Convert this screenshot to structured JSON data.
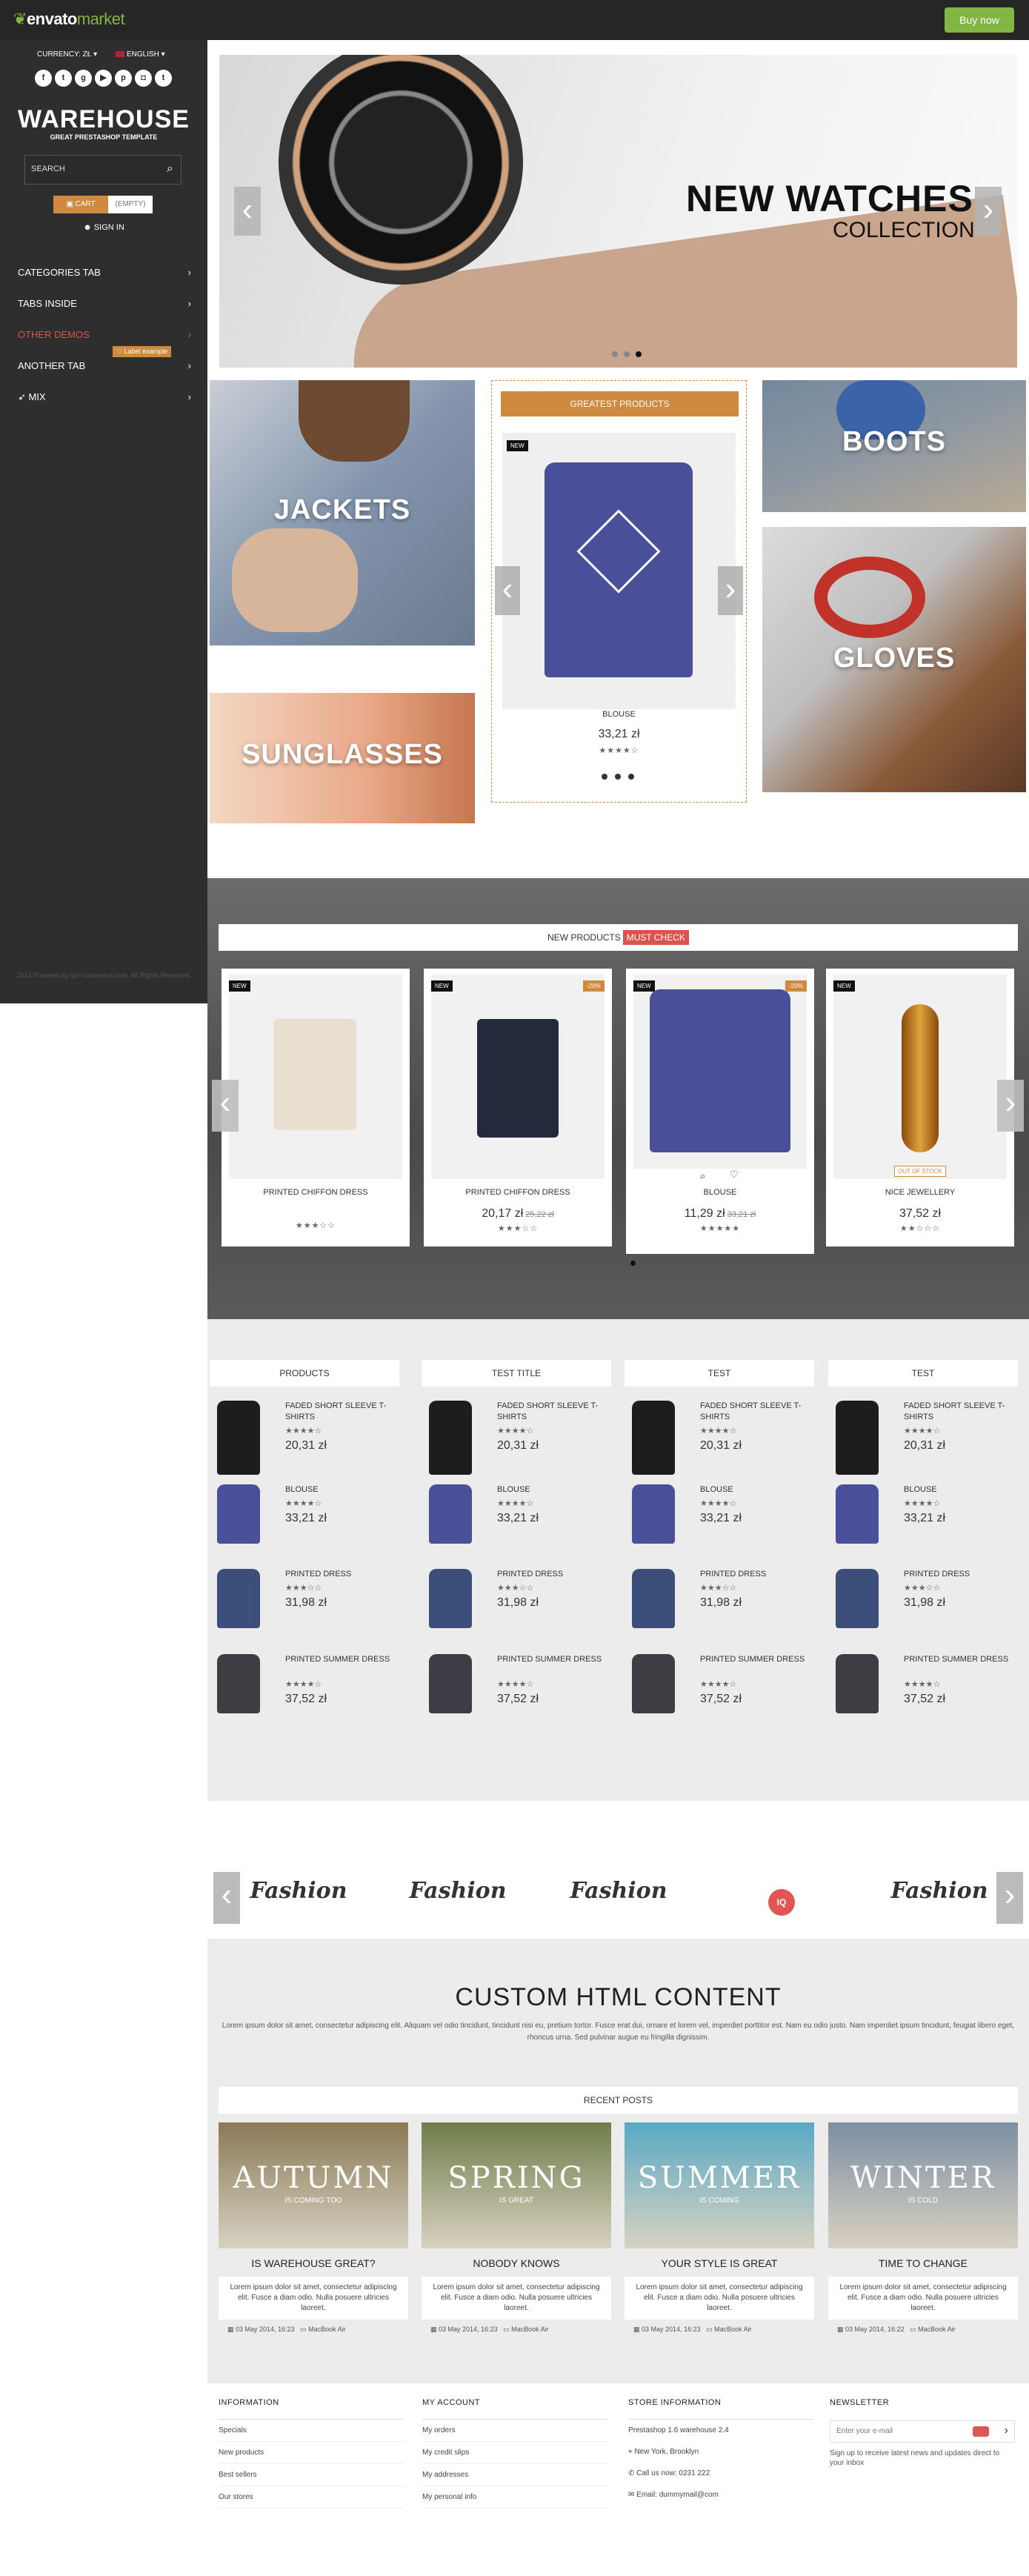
{
  "topbar": {
    "logo_main": "envato",
    "logo_accent": "market",
    "buy_label": "Buy now"
  },
  "sidebar": {
    "currency": "CURRENCY: ZŁ",
    "language": "ENGLISH",
    "socials": [
      "f",
      "t",
      "g+",
      "yt",
      "p",
      "ig",
      "tt"
    ],
    "title": "WAREHOUSE",
    "subtitle": "GREAT PRESTASHOP TEMPLATE",
    "search_placeholder": "SEARCH",
    "cart_label": "CART",
    "cart_state": "(EMPTY)",
    "signin": "SIGN IN",
    "nav": [
      {
        "label": "CATEGORIES TAB"
      },
      {
        "label": "TABS INSIDE"
      },
      {
        "label": "OTHER DEMOS"
      },
      {
        "label": "ANOTHER TAB"
      },
      {
        "label": "MIX"
      }
    ],
    "label_example": "Label example",
    "copyright": "2014 Powered by rps-commerce.com. All Rights Reserved."
  },
  "slider": {
    "title": "NEW WATCHES",
    "subtitle": "COLLECTION"
  },
  "banners": {
    "jackets": "JACKETS",
    "sunglasses": "SUNGLASSES",
    "boots": "BOOTS",
    "gloves": "GLOVES"
  },
  "greatest": {
    "header": "GREATEST PRODUCTS",
    "tag": "NEW",
    "name": "BLOUSE",
    "price": "33,21 zł",
    "stars": "★★★★☆"
  },
  "new_products": {
    "header": "NEW PRODUCTS",
    "must": "MUST CHECK",
    "items": [
      {
        "tag": "NEW",
        "sale": "",
        "name": "PRINTED CHIFFON DRESS",
        "price": "",
        "old": "",
        "stars": "★★★☆☆"
      },
      {
        "tag": "NEW",
        "sale": "-20%",
        "name": "PRINTED CHIFFON DRESS",
        "price": "20,17 zł",
        "old": "25,22 zł",
        "stars": "★★★☆☆"
      },
      {
        "tag": "NEW",
        "sale": "-20%",
        "name": "BLOUSE",
        "price": "11,29 zł",
        "old": "33,21 zł",
        "stars": "★★★★★"
      },
      {
        "tag": "NEW",
        "sale": "",
        "name": "NICE JEWELLERY",
        "price": "37,52 zł",
        "old": "",
        "stars": "★★☆☆☆",
        "stock": "OUT OF STOCK"
      }
    ]
  },
  "lists": {
    "columns": [
      {
        "head": "PRODUCTS"
      },
      {
        "head": "TEST TITLE"
      },
      {
        "head": "TEST"
      },
      {
        "head": "TEST"
      }
    ],
    "items": [
      {
        "name": "FADED SHORT SLEEVE T-SHIRTS",
        "price": "20,31 zł",
        "stars": "★★★★☆"
      },
      {
        "name": "BLOUSE",
        "price": "33,21 zł",
        "stars": "★★★★☆"
      },
      {
        "name": "PRINTED DRESS",
        "price": "31,98 zł",
        "stars": "★★★☆☆"
      },
      {
        "name": "PRINTED SUMMER DRESS",
        "price": "37,52 zł",
        "stars": "★★★★☆"
      }
    ]
  },
  "brands": [
    "Fashion",
    "Fashion",
    "Fashion",
    "IQ",
    "Fashion"
  ],
  "custom": {
    "title": "CUSTOM HTML CONTENT",
    "text": "Lorem ipsum dolor sit amet, consectetur adipiscing elit. Aliquam vel odio tincidunt, tincidunt nisi eu, pretium tortor. Fusce erat dui, ornare et lorem vel, imperdiet porttitor est. Nam eu odio justo. Nam imperdiet ipsum tincidunt, feugiat libero eget, rhoncus urna. Sed pulvinar augue eu fringilla dignissim."
  },
  "recent_posts": {
    "header": "RECENT POSTS",
    "posts": [
      {
        "word": "AUTUMN",
        "sub": "IS COMING TOO",
        "title": "IS WAREHOUSE GREAT?",
        "text": "Lorem ipsum dolor sit amet, consectetur adipiscing elit. Fusce a diam odio. Nulla posuere ultricies laoreet.",
        "date": "03 May 2014, 16:23",
        "author": "MacBook Air",
        "bg": "#8a7a56"
      },
      {
        "word": "SPRING",
        "sub": "IS GREAT",
        "title": "NOBODY KNOWS",
        "text": "Lorem ipsum dolor sit amet, consectetur adipiscing elit. Fusce a diam odio. Nulla posuere ultricies laoreet.",
        "date": "03 May 2014, 16:23",
        "author": "MacBook Air",
        "bg": "#6f7d4a"
      },
      {
        "word": "SUMMER",
        "sub": "IS COMING",
        "title": "YOUR STYLE IS GREAT",
        "text": "Lorem ipsum dolor sit amet, consectetur adipiscing elit. Fusce a diam odio. Nulla posuere ultricies laoreet.",
        "date": "03 May 2014, 16:23",
        "author": "MacBook Air",
        "bg": "#59a9c4"
      },
      {
        "word": "WINTER",
        "sub": "IS COLD",
        "title": "TIME TO CHANGE",
        "text": "Lorem ipsum dolor sit amet, consectetur adipiscing elit. Fusce a diam odio. Nulla posuere ultricies laoreet.",
        "date": "03 May 2014, 16:22",
        "author": "MacBook Air",
        "bg": "#7d8fa3"
      }
    ]
  },
  "footer": {
    "information": {
      "head": "INFORMATION",
      "links": [
        "Specials",
        "New products",
        "Best sellers",
        "Our stores"
      ]
    },
    "account": {
      "head": "MY ACCOUNT",
      "links": [
        "My orders",
        "My credit slips",
        "My addresses",
        "My personal info"
      ]
    },
    "store": {
      "head": "STORE INFORMATION",
      "lines": [
        "Prestashop 1.6 warehouse 2.4",
        "New York, Brooklyn",
        "Call us now: 0231 222",
        "Email: dummymail@com"
      ]
    },
    "newsletter": {
      "head": "NEWSLETTER",
      "placeholder": "Enter your e-mail",
      "note": "Sign up to receive latest news and updates direct to your inbox"
    }
  }
}
